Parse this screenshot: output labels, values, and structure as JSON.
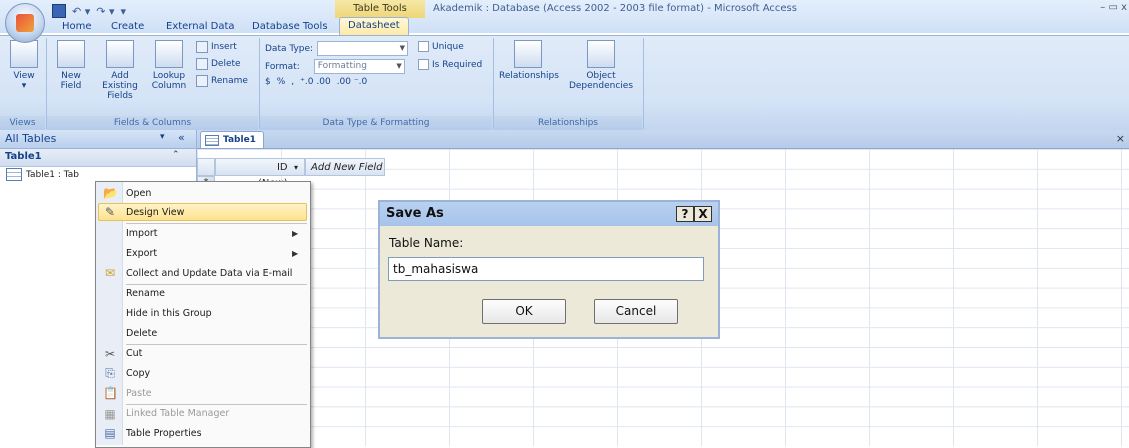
{
  "window": {
    "tools_tab": "Table Tools",
    "title": "Akademik : Database (Access 2002 - 2003 file format) - Microsoft Access",
    "controls": "– ▭ x"
  },
  "ribbon_tabs": [
    "Home",
    "Create",
    "External Data",
    "Database Tools",
    "Datasheet"
  ],
  "ribbon": {
    "views": {
      "view_label": "View",
      "group": "Views"
    },
    "fields_columns": {
      "new_field": "New Field",
      "add_existing": "Add Existing Fields",
      "lookup": "Lookup Column",
      "insert": "Insert",
      "delete": "Delete",
      "rename": "Rename",
      "group": "Fields & Columns"
    },
    "data_type": {
      "data_type_label": "Data Type:",
      "format_label": "Format:",
      "format_value": "Formatting",
      "unique": "Unique",
      "is_required": "Is Required",
      "currency": "$",
      "percent": "%",
      "comma": ",",
      "increase_dec": "⁺.0 .00",
      "decrease_dec": ".00 ⁻.0",
      "group": "Data Type & Formatting"
    },
    "relationships": {
      "relationships": "Relationships",
      "object_dep": "Object Dependencies",
      "group": "Relationships"
    }
  },
  "nav": {
    "header": "All Tables",
    "group": "Table1",
    "item": "Table1 : Tab"
  },
  "doc_tab": "Table1",
  "grid": {
    "id_header": "ID",
    "add_field_header": "Add New Field",
    "new_row_marker": "*",
    "new_value": "(New)"
  },
  "context_menu": [
    {
      "label": "Open",
      "icon": "open-icon"
    },
    {
      "label": "Design View",
      "icon": "design-view-icon"
    },
    {
      "label": "Import",
      "icon": ""
    },
    {
      "label": "Export",
      "icon": ""
    },
    {
      "label": "Collect and Update Data via E-mail",
      "icon": "email-icon"
    },
    {
      "label": "Rename",
      "icon": ""
    },
    {
      "label": "Hide in this Group",
      "icon": ""
    },
    {
      "label": "Delete",
      "icon": ""
    },
    {
      "label": "Cut",
      "icon": "scissors-icon"
    },
    {
      "label": "Copy",
      "icon": "copy-icon"
    },
    {
      "label": "Paste",
      "icon": "paste-icon"
    },
    {
      "label": "Linked Table Manager",
      "icon": "linked-table-icon"
    },
    {
      "label": "Table Properties",
      "icon": "properties-icon"
    }
  ],
  "dialog": {
    "title": "Save As",
    "help": "?",
    "close": "X",
    "label": "Table Name:",
    "value": "tb_mahasiswa",
    "ok": "OK",
    "cancel": "Cancel"
  }
}
